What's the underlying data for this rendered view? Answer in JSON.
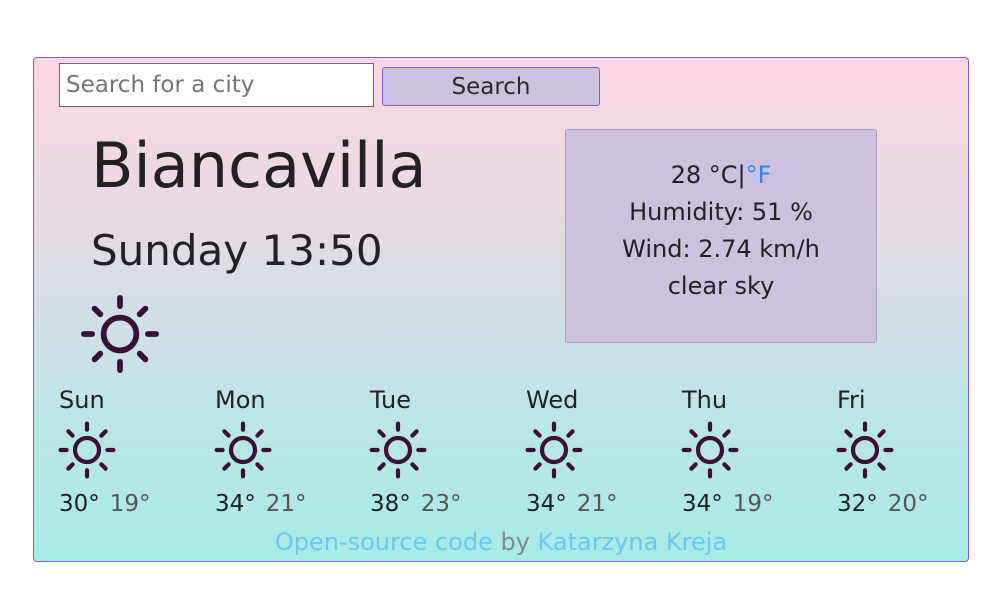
{
  "search": {
    "placeholder": "Search for a city",
    "value": "",
    "button_label": "Search"
  },
  "current": {
    "city": "Biancavilla",
    "datetime": "Sunday 13:50",
    "icon": "sun-icon",
    "temperature": "28",
    "unit_celsius": "°C",
    "unit_separator": "|",
    "unit_fahrenheit": "°F",
    "humidity": "Humidity: 51 %",
    "wind": "Wind: 2.74 km/h",
    "description": "clear sky"
  },
  "forecast": [
    {
      "day": "Sun",
      "icon": "sun-icon",
      "max": "30°",
      "min": "19°"
    },
    {
      "day": "Mon",
      "icon": "sun-icon",
      "max": "34°",
      "min": "21°"
    },
    {
      "day": "Tue",
      "icon": "sun-icon",
      "max": "38°",
      "min": "23°"
    },
    {
      "day": "Wed",
      "icon": "sun-icon",
      "max": "34°",
      "min": "21°"
    },
    {
      "day": "Thu",
      "icon": "sun-icon",
      "max": "34°",
      "min": "19°"
    },
    {
      "day": "Fri",
      "icon": "sun-icon",
      "max": "32°",
      "min": "20°"
    }
  ],
  "footer": {
    "code_link": "Open-source code",
    "by_text": "by",
    "author_link": "Katarzyna Kreja"
  },
  "colors": {
    "accent_border": "#7a5fd6",
    "panel": "#cdc1e0",
    "link_blue": "#2f86f5",
    "footer_link": "#6cc7f2",
    "icon_color": "#3a1038"
  }
}
